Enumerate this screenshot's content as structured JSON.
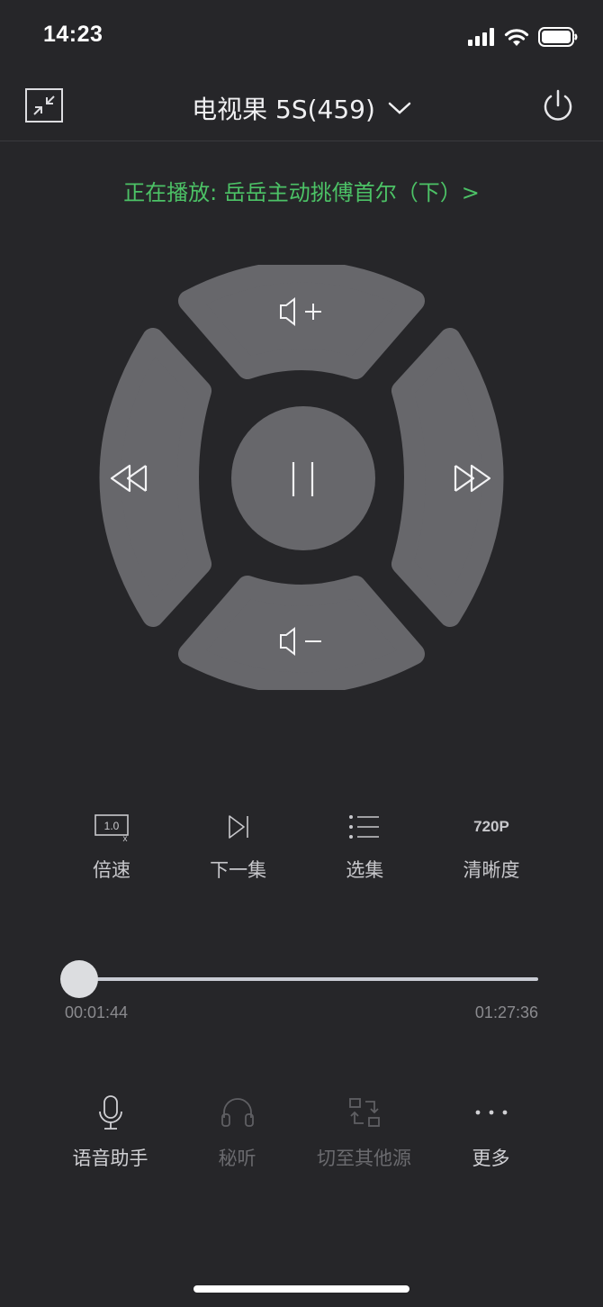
{
  "status_bar": {
    "time": "14:23",
    "icons": [
      "cellular-signal-icon",
      "wifi-icon",
      "battery-icon"
    ]
  },
  "header": {
    "collapse_icon": "collapse-arrows-icon",
    "device_name": "电视果 5S(459)",
    "dropdown_icon": "chevron-down-icon",
    "power_icon": "power-icon"
  },
  "now_playing": {
    "text": "正在播放: 岳岳主动挑傅首尔（下）>"
  },
  "remote": {
    "top": "volume-up-icon",
    "bottom": "volume-down-icon",
    "left": "rewind-icon",
    "right": "fast-forward-icon",
    "center": "pause-icon",
    "colors": {
      "pad": "#67676b",
      "background": "#262629"
    }
  },
  "quick_actions": [
    {
      "icon": "speed-icon",
      "icon_text": "1.0",
      "icon_sub": "x",
      "label": "倍速"
    },
    {
      "icon": "next-episode-icon",
      "label": "下一集"
    },
    {
      "icon": "episode-list-icon",
      "label": "选集"
    },
    {
      "icon": "resolution-icon",
      "icon_text": "720P",
      "label": "清晰度"
    }
  ],
  "progress": {
    "current": "00:01:44",
    "total": "01:27:36",
    "fraction": 0.02
  },
  "tools": [
    {
      "icon": "microphone-icon",
      "label": "语音助手",
      "enabled": true
    },
    {
      "icon": "headphones-icon",
      "label": "秘听",
      "enabled": false
    },
    {
      "icon": "switch-source-icon",
      "label": "切至其他源",
      "enabled": false
    },
    {
      "icon": "more-dots-icon",
      "label": "更多",
      "enabled": true
    }
  ],
  "colors": {
    "accent_green": "#4cc266",
    "background": "#262629"
  }
}
